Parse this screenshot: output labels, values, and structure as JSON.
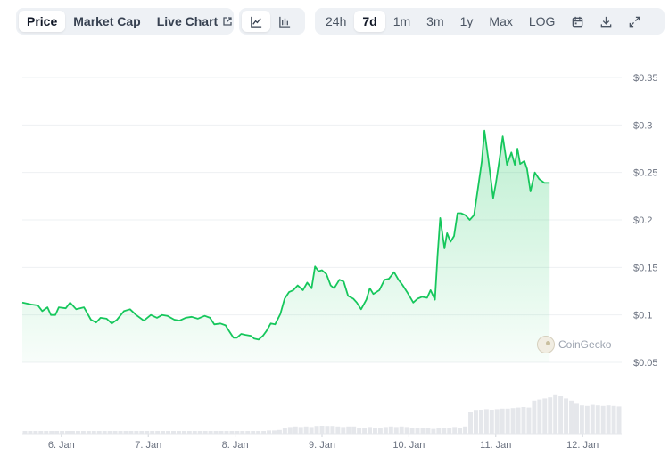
{
  "tabs": {
    "price": "Price",
    "market_cap": "Market Cap",
    "live_chart": "Live Chart"
  },
  "chart_type_icons": [
    "line-chart-icon",
    "candlestick-chart-icon"
  ],
  "ranges": {
    "r24h": "24h",
    "r7d": "7d",
    "r1m": "1m",
    "r3m": "3m",
    "r1y": "1y",
    "max": "Max",
    "log": "LOG"
  },
  "tool_icons": [
    "calendar-icon",
    "download-icon",
    "expand-icon"
  ],
  "watermark": "CoinGecko",
  "colors": {
    "line": "#16c75c",
    "volume": "#e5e7eb",
    "grid": "#eef0f3"
  },
  "chart_data": {
    "type": "line",
    "x_ticks": [
      "6. Jan",
      "7. Jan",
      "8. Jan",
      "9. Jan",
      "10. Jan",
      "11. Jan",
      "12. Jan"
    ],
    "y_ticks": [
      "$0.05",
      "$0.1",
      "$0.15",
      "$0.2",
      "$0.25",
      "$0.3",
      "$0.35"
    ],
    "y_tick_values": [
      0.05,
      0.1,
      0.15,
      0.2,
      0.25,
      0.3,
      0.35
    ],
    "ylim": [
      0.05,
      0.35
    ],
    "xlim": [
      5.55,
      12.45
    ],
    "grid": true,
    "series": [
      {
        "points": [
          [
            5.55,
            0.113
          ],
          [
            5.65,
            0.111
          ],
          [
            5.73,
            0.11
          ],
          [
            5.78,
            0.104
          ],
          [
            5.84,
            0.108
          ],
          [
            5.88,
            0.1
          ],
          [
            5.93,
            0.1
          ],
          [
            5.97,
            0.108
          ],
          [
            6.05,
            0.107
          ],
          [
            6.1,
            0.113
          ],
          [
            6.17,
            0.106
          ],
          [
            6.26,
            0.108
          ],
          [
            6.34,
            0.095
          ],
          [
            6.4,
            0.092
          ],
          [
            6.45,
            0.097
          ],
          [
            6.52,
            0.096
          ],
          [
            6.58,
            0.091
          ],
          [
            6.64,
            0.095
          ],
          [
            6.72,
            0.104
          ],
          [
            6.79,
            0.106
          ],
          [
            6.86,
            0.1
          ],
          [
            6.95,
            0.094
          ],
          [
            7.03,
            0.1
          ],
          [
            7.1,
            0.097
          ],
          [
            7.16,
            0.1
          ],
          [
            7.22,
            0.099
          ],
          [
            7.3,
            0.095
          ],
          [
            7.36,
            0.094
          ],
          [
            7.43,
            0.097
          ],
          [
            7.5,
            0.098
          ],
          [
            7.57,
            0.096
          ],
          [
            7.65,
            0.099
          ],
          [
            7.71,
            0.097
          ],
          [
            7.76,
            0.09
          ],
          [
            7.83,
            0.091
          ],
          [
            7.89,
            0.089
          ],
          [
            7.93,
            0.083
          ],
          [
            7.98,
            0.076
          ],
          [
            8.02,
            0.076
          ],
          [
            8.07,
            0.08
          ],
          [
            8.12,
            0.079
          ],
          [
            8.18,
            0.078
          ],
          [
            8.22,
            0.075
          ],
          [
            8.27,
            0.074
          ],
          [
            8.32,
            0.078
          ],
          [
            8.36,
            0.083
          ],
          [
            8.41,
            0.091
          ],
          [
            8.46,
            0.09
          ],
          [
            8.52,
            0.101
          ],
          [
            8.57,
            0.117
          ],
          [
            8.62,
            0.124
          ],
          [
            8.67,
            0.126
          ],
          [
            8.72,
            0.131
          ],
          [
            8.78,
            0.126
          ],
          [
            8.83,
            0.134
          ],
          [
            8.88,
            0.128
          ],
          [
            8.92,
            0.151
          ],
          [
            8.96,
            0.146
          ],
          [
            9.0,
            0.147
          ],
          [
            9.05,
            0.143
          ],
          [
            9.1,
            0.131
          ],
          [
            9.14,
            0.128
          ],
          [
            9.2,
            0.137
          ],
          [
            9.25,
            0.135
          ],
          [
            9.3,
            0.12
          ],
          [
            9.36,
            0.117
          ],
          [
            9.4,
            0.113
          ],
          [
            9.45,
            0.106
          ],
          [
            9.51,
            0.116
          ],
          [
            9.55,
            0.128
          ],
          [
            9.59,
            0.122
          ],
          [
            9.66,
            0.126
          ],
          [
            9.72,
            0.137
          ],
          [
            9.77,
            0.138
          ],
          [
            9.83,
            0.145
          ],
          [
            9.88,
            0.137
          ],
          [
            9.93,
            0.131
          ],
          [
            9.98,
            0.124
          ],
          [
            10.05,
            0.113
          ],
          [
            10.1,
            0.117
          ],
          [
            10.15,
            0.119
          ],
          [
            10.21,
            0.118
          ],
          [
            10.25,
            0.126
          ],
          [
            10.3,
            0.116
          ],
          [
            10.33,
            0.162
          ],
          [
            10.36,
            0.202
          ],
          [
            10.41,
            0.17
          ],
          [
            10.44,
            0.186
          ],
          [
            10.48,
            0.177
          ],
          [
            10.52,
            0.183
          ],
          [
            10.56,
            0.207
          ],
          [
            10.6,
            0.207
          ],
          [
            10.65,
            0.205
          ],
          [
            10.7,
            0.2
          ],
          [
            10.75,
            0.205
          ],
          [
            10.79,
            0.23
          ],
          [
            10.84,
            0.262
          ],
          [
            10.87,
            0.294
          ],
          [
            10.92,
            0.26
          ],
          [
            10.97,
            0.223
          ],
          [
            11.0,
            0.238
          ],
          [
            11.04,
            0.262
          ],
          [
            11.08,
            0.288
          ],
          [
            11.13,
            0.258
          ],
          [
            11.18,
            0.271
          ],
          [
            11.22,
            0.258
          ],
          [
            11.25,
            0.275
          ],
          [
            11.28,
            0.259
          ],
          [
            11.33,
            0.262
          ],
          [
            11.36,
            0.254
          ],
          [
            11.4,
            0.23
          ],
          [
            11.45,
            0.25
          ],
          [
            11.5,
            0.243
          ],
          [
            11.56,
            0.239
          ],
          [
            11.62,
            0.239
          ]
        ]
      }
    ],
    "volume_hint": [
      0.5,
      0.5,
      0.5,
      0.5,
      0.5,
      0.5,
      0.5,
      0.5,
      0.5,
      0.5,
      0.5,
      0.5,
      0.5,
      0.5,
      0.5,
      0.5,
      0.5,
      0.5,
      0.5,
      0.5,
      0.5,
      0.5,
      0.5,
      0.5,
      0.5,
      0.5,
      0.5,
      0.5,
      0.5,
      0.5,
      0.5,
      0.5,
      0.5,
      0.5,
      0.5,
      0.5,
      0.5,
      0.5,
      0.5,
      0.5,
      0.5,
      0.5,
      0.5,
      0.5,
      0.5,
      0.5,
      0.6,
      0.6,
      0.7,
      1.0,
      1.1,
      1.2,
      1.1,
      1.2,
      1.1,
      1.3,
      1.4,
      1.3,
      1.3,
      1.2,
      1.1,
      1.2,
      1.2,
      1.0,
      1.0,
      1.1,
      1.0,
      1.0,
      1.1,
      1.2,
      1.1,
      1.2,
      1.1,
      1.0,
      1.0,
      1.0,
      1.0,
      0.9,
      1.0,
      1.0,
      1.0,
      1.1,
      1.0,
      1.2,
      4.0,
      4.3,
      4.5,
      4.6,
      4.5,
      4.6,
      4.7,
      4.7,
      4.8,
      4.9,
      5.0,
      4.9,
      6.2,
      6.4,
      6.6,
      6.8,
      7.2,
      7.0,
      6.6,
      6.2,
      5.6,
      5.3,
      5.2,
      5.4,
      5.3,
      5.2,
      5.3,
      5.2,
      5.1
    ]
  }
}
